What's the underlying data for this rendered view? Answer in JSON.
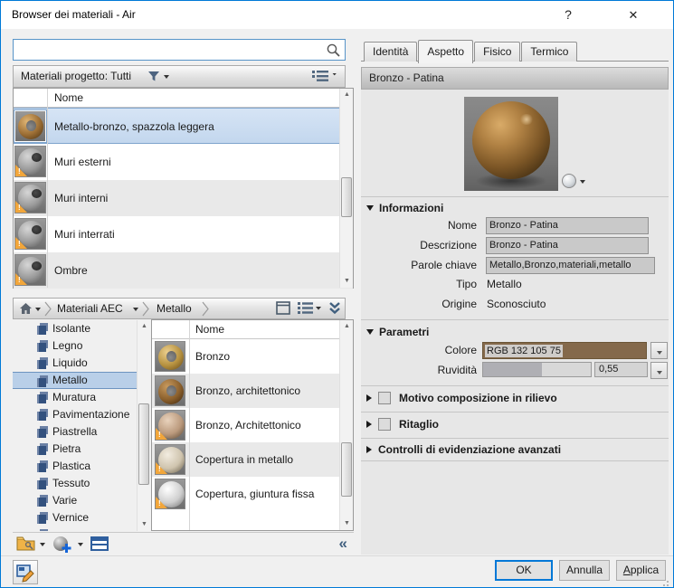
{
  "window": {
    "title": "Browser dei materiali - Air",
    "help_label": "?",
    "close_label": "✕"
  },
  "search": {
    "placeholder": "",
    "value": ""
  },
  "project_bar": {
    "label": "Materiali progetto: Tutti"
  },
  "top_list": {
    "header": "Nome",
    "rows": [
      {
        "name": "Metallo-bronzo, spazzola leggera",
        "selected": true
      },
      {
        "name": "Muri esterni",
        "selected": false
      },
      {
        "name": "Muri interni",
        "selected": false
      },
      {
        "name": "Muri interrati",
        "selected": false
      },
      {
        "name": "Ombre",
        "selected": false
      }
    ]
  },
  "breadcrumb": {
    "items": [
      "Materiali AEC",
      "Metallo"
    ]
  },
  "tree": {
    "selected": "Metallo",
    "items": [
      "Isolante",
      "Legno",
      "Liquido",
      "Metallo",
      "Muratura",
      "Pavimentazione",
      "Piastrella",
      "Pietra",
      "Plastica",
      "Tessuto",
      "Varie",
      "Vernice"
    ]
  },
  "sub_list": {
    "header": "Nome",
    "rows": [
      {
        "name": "Bronzo"
      },
      {
        "name": "Bronzo, architettonico"
      },
      {
        "name": "Bronzo, Architettonico"
      },
      {
        "name": "Copertura in metallo"
      },
      {
        "name": "Copertura, giuntura fissa"
      }
    ]
  },
  "tabs": {
    "t0": "Identità",
    "t1": "Aspetto",
    "t2": "Fisico",
    "t3": "Termico",
    "active": "Aspetto"
  },
  "appearance": {
    "header": "Bronzo - Patina"
  },
  "info": {
    "title": "Informazioni",
    "name_label": "Nome",
    "name_value": "Bronzo - Patina",
    "desc_label": "Descrizione",
    "desc_value": "Bronzo - Patina",
    "keywords_label": "Parole chiave",
    "keywords_value": "Metallo,Bronzo,materiali,metallo",
    "type_label": "Tipo",
    "type_value": "Metallo",
    "origin_label": "Origine",
    "origin_value": "Sconosciuto"
  },
  "params": {
    "title": "Parametri",
    "color_label": "Colore",
    "color_value": "RGB 132 105 75",
    "color_hex": "#84694B",
    "roughness_label": "Ruvidità",
    "roughness_value": "0,55",
    "roughness_pct": 55
  },
  "sections": {
    "relief": "Motivo composizione in rilievo",
    "cutout": "Ritaglio",
    "advanced": "Controlli di evidenziazione avanzati"
  },
  "footer": {
    "ok": "OK",
    "cancel": "Annulla",
    "apply": "Applica"
  }
}
